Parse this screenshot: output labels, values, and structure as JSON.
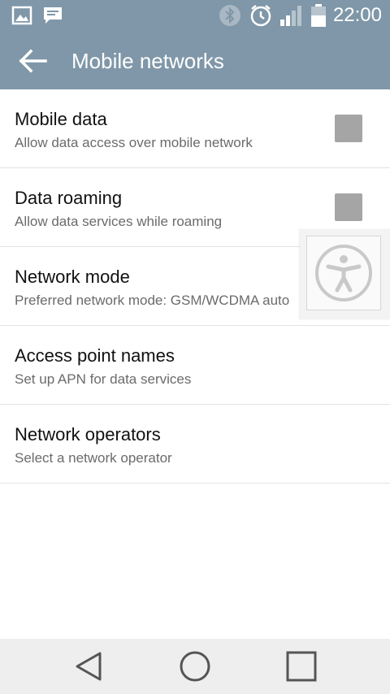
{
  "status_bar": {
    "time": "22:00",
    "icons": [
      "image-notification-icon",
      "message-notification-icon",
      "bluetooth-icon",
      "alarm-icon",
      "signal-icon",
      "battery-icon"
    ]
  },
  "app_bar": {
    "title": "Mobile networks",
    "back_icon": "arrow-left-icon"
  },
  "settings": [
    {
      "title": "Mobile data",
      "subtitle": "Allow data access over mobile network",
      "checkbox": true
    },
    {
      "title": "Data roaming",
      "subtitle": "Allow data services while roaming",
      "checkbox": true
    },
    {
      "title": "Network mode",
      "subtitle": "Preferred network mode: GSM/WCDMA auto",
      "checkbox": false
    },
    {
      "title": "Access point names",
      "subtitle": "Set up APN for data services",
      "checkbox": false
    },
    {
      "title": "Network operators",
      "subtitle": "Select a network operator",
      "checkbox": false
    }
  ],
  "accessibility_button": {
    "icon": "accessibility-icon"
  },
  "nav_bar": {
    "icons": [
      "back-triangle-icon",
      "home-circle-icon",
      "recents-square-icon"
    ]
  },
  "colors": {
    "header": "#7f97a8",
    "checkbox": "#a5a5a5",
    "nav": "#eeeeee"
  }
}
